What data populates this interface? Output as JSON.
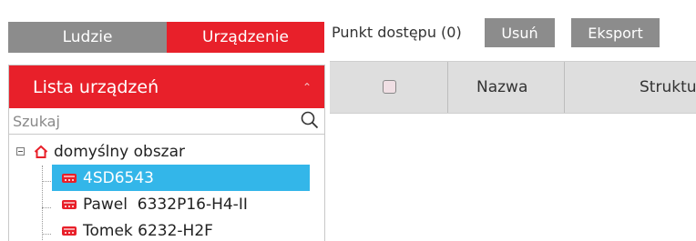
{
  "tabs": {
    "people": "Ludzie",
    "devices": "Urządzenie"
  },
  "device_list": {
    "title": "Lista urządzeń",
    "search_placeholder": "Szukaj",
    "root": {
      "label": "domyślny obszar"
    },
    "devices": [
      {
        "label": "4SD6543",
        "selected": true
      },
      {
        "label": "Pawel  6332P16-H4-II",
        "selected": false
      },
      {
        "label": "Tomek 6232-H2F",
        "selected": false
      }
    ]
  },
  "access_points": {
    "label": "Punkt dostępu (0)",
    "delete_button": "Usuń",
    "export_button": "Eksport",
    "columns": {
      "name": "Nazwa",
      "structure": "Struktura"
    }
  },
  "colors": {
    "accent_red": "#e8202a",
    "tab_gray": "#8c8c8c",
    "selection_blue": "#33b6e9",
    "header_gray": "#dedede"
  },
  "icons": [
    "search-icon",
    "home-icon",
    "device-icon",
    "collapse-icon",
    "tree-expander-icon"
  ]
}
